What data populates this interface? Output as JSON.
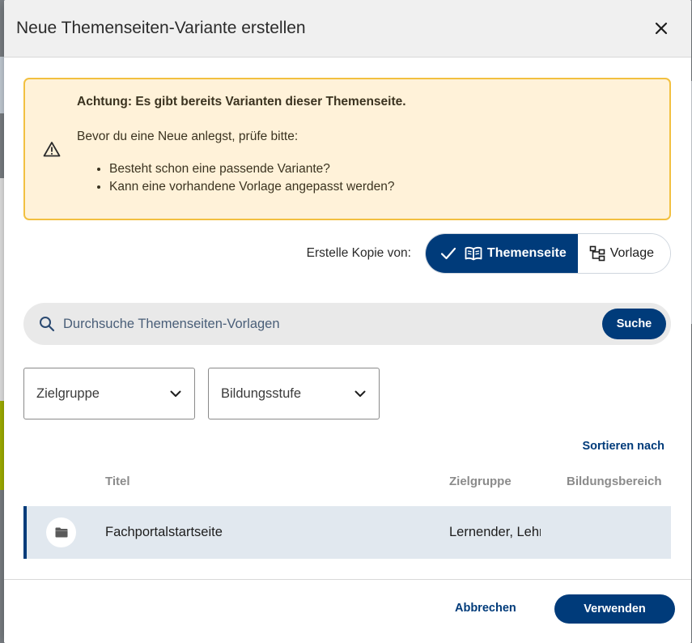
{
  "dialog": {
    "title": "Neue Themenseiten-Variante erstellen",
    "close_icon": "close-icon"
  },
  "warning": {
    "icon": "warning-triangle-icon",
    "heading": "Achtung: Es gibt bereits Varianten dieser Themenseite.",
    "text": "Bevor du eine Neue anlegst, prüfe bitte:",
    "items": [
      "Besteht schon eine passende Variante?",
      "Kann eine vorhandene Vorlage angepasst werden?"
    ],
    "colors": {
      "background": "#fff2d9",
      "border": "#f2c040"
    }
  },
  "copy_source": {
    "label": "Erstelle Kopie von:",
    "options": [
      {
        "label": "Themenseite",
        "icon": "book-icon",
        "selected": true
      },
      {
        "label": "Vorlage",
        "icon": "hierarchy-icon",
        "selected": false
      }
    ]
  },
  "search": {
    "placeholder": "Durchsuche Themenseiten-Vorlagen",
    "value": "",
    "button_label": "Suche"
  },
  "filters": [
    {
      "label": "Zielgruppe"
    },
    {
      "label": "Bildungsstufe"
    }
  ],
  "sort_label": "Sortieren nach",
  "table": {
    "columns": [
      "Titel",
      "Zielgruppe",
      "Bildungsbereich"
    ],
    "rows": [
      {
        "icon": "folder-icon",
        "title": "Fachportalstartseite",
        "zielgruppe": "Lernender, Lehrer",
        "bildungsbereich": "",
        "selected": true
      }
    ]
  },
  "footer": {
    "cancel_label": "Abbrechen",
    "use_label": "Verwenden"
  },
  "colors": {
    "primary": "#003b7a",
    "row_selected": "#e1e8ef"
  }
}
